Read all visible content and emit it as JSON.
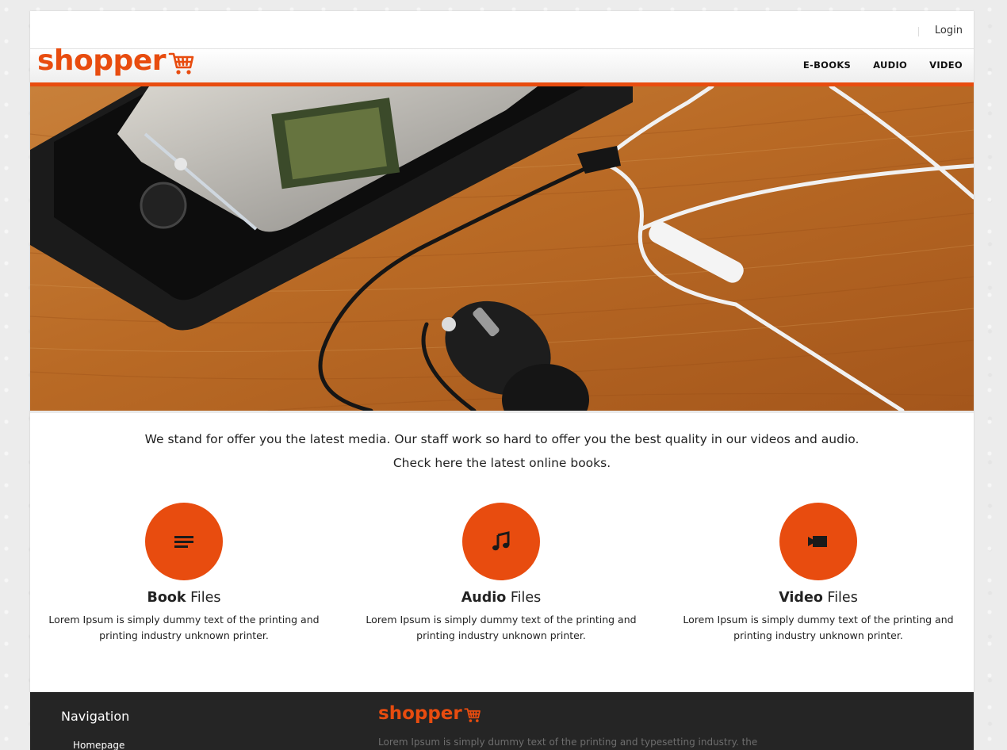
{
  "header": {
    "login_label": "Login",
    "logo_text": "shopper",
    "menu": [
      "E-BOOKS",
      "AUDIO",
      "VIDEO"
    ]
  },
  "intro": {
    "line1": "We stand for offer you the latest media. Our staff work so hard to offer you the best quality in our videos and audio.",
    "line2": "Check here the latest online books."
  },
  "features": [
    {
      "icon": "lines-icon",
      "title_bold": "Book",
      "title_rest": " Files",
      "text": "Lorem Ipsum is simply dummy text of the printing and printing industry unknown printer."
    },
    {
      "icon": "music-note-icon",
      "title_bold": "Audio",
      "title_rest": " Files",
      "text": "Lorem Ipsum is simply dummy text of the printing and printing industry unknown printer."
    },
    {
      "icon": "video-camera-icon",
      "title_bold": "Video",
      "title_rest": " Files",
      "text": "Lorem Ipsum is simply dummy text of the printing and printing industry unknown printer."
    }
  ],
  "footer": {
    "nav_title": "Navigation",
    "nav_link": "Homepage",
    "logo_text": "shopper",
    "text": "Lorem Ipsum is simply dummy text of the printing and typesetting industry. the"
  },
  "colors": {
    "accent": "#e84c0f",
    "footer_bg": "#252525"
  }
}
